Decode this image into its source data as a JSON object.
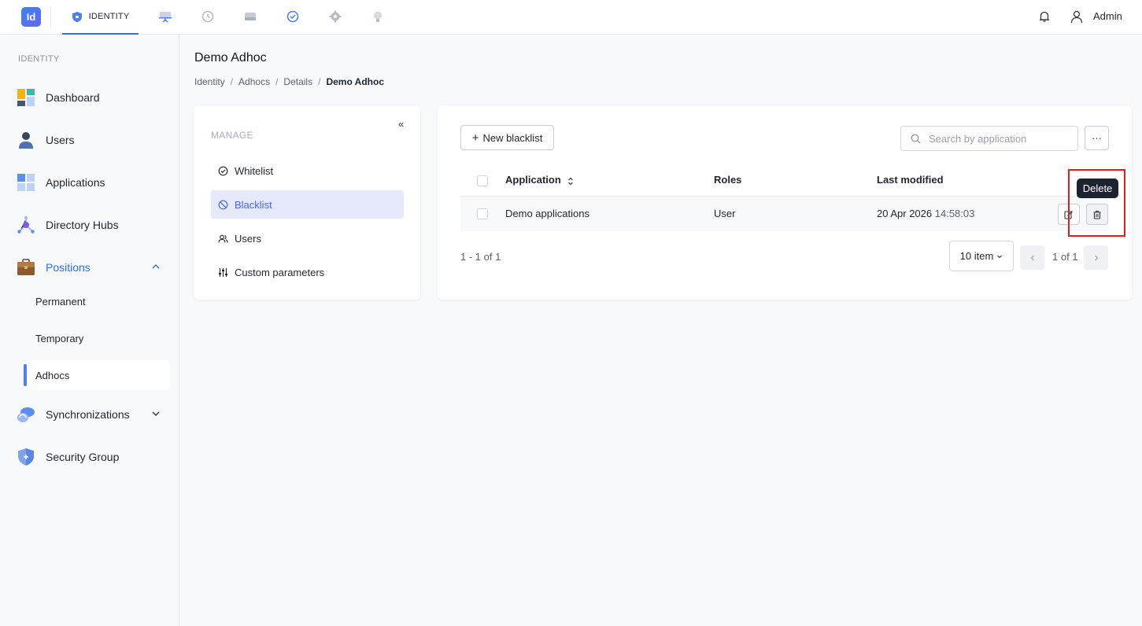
{
  "app": {
    "logo_text": "Id",
    "active_module": "IDENTITY",
    "user_name": "Admin"
  },
  "top_icons": [
    "shield-icon",
    "presentation-icon",
    "history-icon",
    "drive-icon",
    "clock-check-icon",
    "gear-icon",
    "bulb-icon"
  ],
  "sidebar": {
    "section": "IDENTITY",
    "items": [
      {
        "label": "Dashboard",
        "icon": "dashboard-icon"
      },
      {
        "label": "Users",
        "icon": "user-icon"
      },
      {
        "label": "Applications",
        "icon": "applications-icon"
      },
      {
        "label": "Directory Hubs",
        "icon": "hub-icon"
      },
      {
        "label": "Positions",
        "icon": "briefcase-icon",
        "expanded": true
      },
      {
        "label": "Synchronizations",
        "icon": "cloud-sync-icon",
        "expanded": false
      },
      {
        "label": "Security Group",
        "icon": "shield-icon"
      }
    ],
    "sub_items": [
      "Permanent",
      "Temporary",
      "Adhocs"
    ],
    "active_sub": "Adhocs"
  },
  "page": {
    "title": "Demo Adhoc",
    "breadcrumb": [
      "Identity",
      "Adhocs",
      "Details",
      "Demo Adhoc"
    ],
    "separator": "/"
  },
  "manage": {
    "title": "MANAGE",
    "collapse_glyph": "«",
    "items": [
      {
        "label": "Whitelist",
        "icon": "check-circle-icon"
      },
      {
        "label": "Blacklist",
        "icon": "ban-icon"
      },
      {
        "label": "Users",
        "icon": "users-icon"
      },
      {
        "label": "Custom parameters",
        "icon": "sliders-icon"
      }
    ],
    "active": "Blacklist"
  },
  "toolbar": {
    "new_label": "New blacklist",
    "search_placeholder": "Search by application",
    "more_glyph": "···"
  },
  "table": {
    "columns": [
      "Application",
      "Roles",
      "Last modified"
    ],
    "rows": [
      {
        "application": "Demo applications",
        "roles": "User",
        "date": "20 Apr 2026",
        "time": "14:58:03"
      }
    ]
  },
  "tooltip": "Delete",
  "pagination": {
    "range": "1 - 1 of 1",
    "per_page": "10 item",
    "page_text": "1 of 1"
  },
  "colors": {
    "accent": "#2f6fe0",
    "highlight": "#e02020",
    "tooltip_bg": "#1d2230"
  }
}
